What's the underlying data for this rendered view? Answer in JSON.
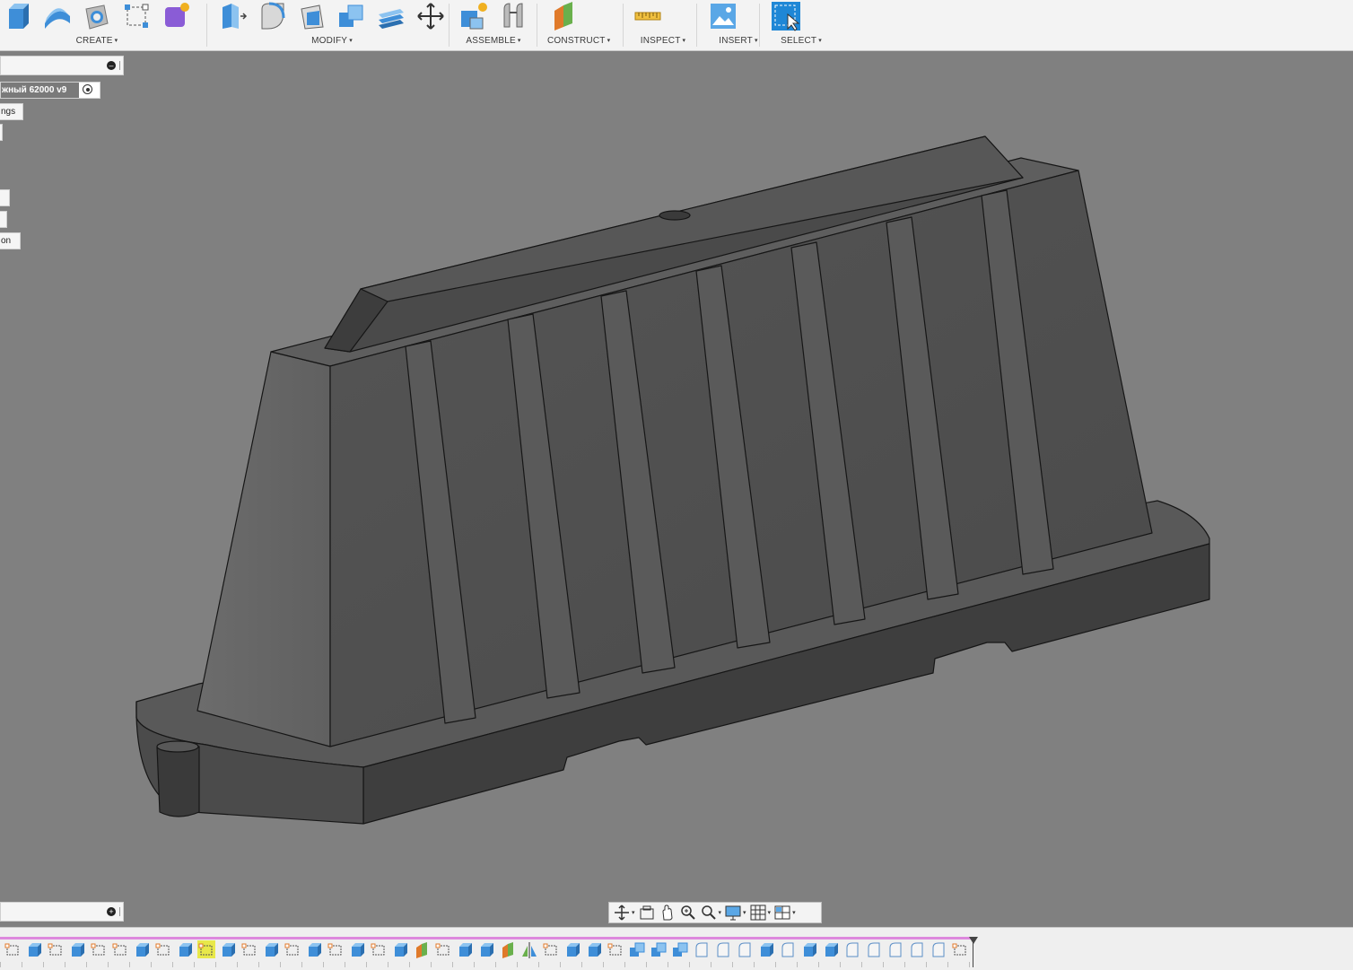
{
  "toolbar": {
    "groups": [
      {
        "id": "create",
        "label": "CREATE",
        "icons": [
          "extrude-icon",
          "sweep-icon",
          "hole-icon",
          "sketch-rect-icon",
          "form-icon"
        ]
      },
      {
        "id": "modify",
        "label": "MODIFY",
        "icons": [
          "press-pull-icon",
          "fillet-icon",
          "shell-icon",
          "combine-icon",
          "offset-face-icon",
          "move-icon"
        ]
      },
      {
        "id": "assemble",
        "label": "ASSEMBLE",
        "icons": [
          "new-component-icon",
          "joint-icon"
        ]
      },
      {
        "id": "construct",
        "label": "CONSTRUCT",
        "icons": [
          "offset-plane-icon"
        ]
      },
      {
        "id": "inspect",
        "label": "INSPECT",
        "icons": [
          "measure-icon"
        ]
      },
      {
        "id": "insert",
        "label": "INSERT",
        "icons": [
          "insert-image-icon"
        ]
      },
      {
        "id": "select",
        "label": "SELECT",
        "icons": [
          "select-icon"
        ]
      }
    ],
    "caret": "▾"
  },
  "browser": {
    "document_name": "жный 62000 v9",
    "tree_items": [
      "ngs",
      "",
      "",
      "",
      "on"
    ]
  },
  "navbar": {
    "items": [
      "orbit-icon",
      "look-at-icon",
      "pan-icon",
      "zoom-window-icon",
      "zoom-icon",
      "display-settings-icon",
      "grid-icon",
      "viewports-icon"
    ]
  },
  "timeline": {
    "items": [
      "sketch",
      "extrude",
      "sketch",
      "extrude",
      "sketch",
      "sketch",
      "extrude",
      "sketch",
      "extrude",
      "sketch",
      "extrude",
      "sketch",
      "extrude",
      "sketch",
      "extrude",
      "sketch",
      "extrude",
      "sketch",
      "extrude",
      "plane",
      "sketch",
      "extrude",
      "extrude",
      "plane",
      "mirror",
      "sketch",
      "extrude",
      "extrude",
      "sketch",
      "combine",
      "combine",
      "combine",
      "fillet",
      "fillet",
      "fillet",
      "extrude",
      "fillet",
      "extrude",
      "extrude",
      "fillet",
      "fillet",
      "fillet",
      "fillet",
      "fillet",
      "sketch"
    ],
    "selected_index": 9
  },
  "colors": {
    "viewport_bg": "#808080",
    "model_face_dark": "#4e4e4e",
    "model_face_mid": "#5a5a5a",
    "model_face_light": "#6a6a6a",
    "model_top": "#5c5c5c",
    "edge": "#1a1a1a",
    "accent_blue": "#3e8ed8",
    "timeline_bar": "#dd88dd"
  }
}
